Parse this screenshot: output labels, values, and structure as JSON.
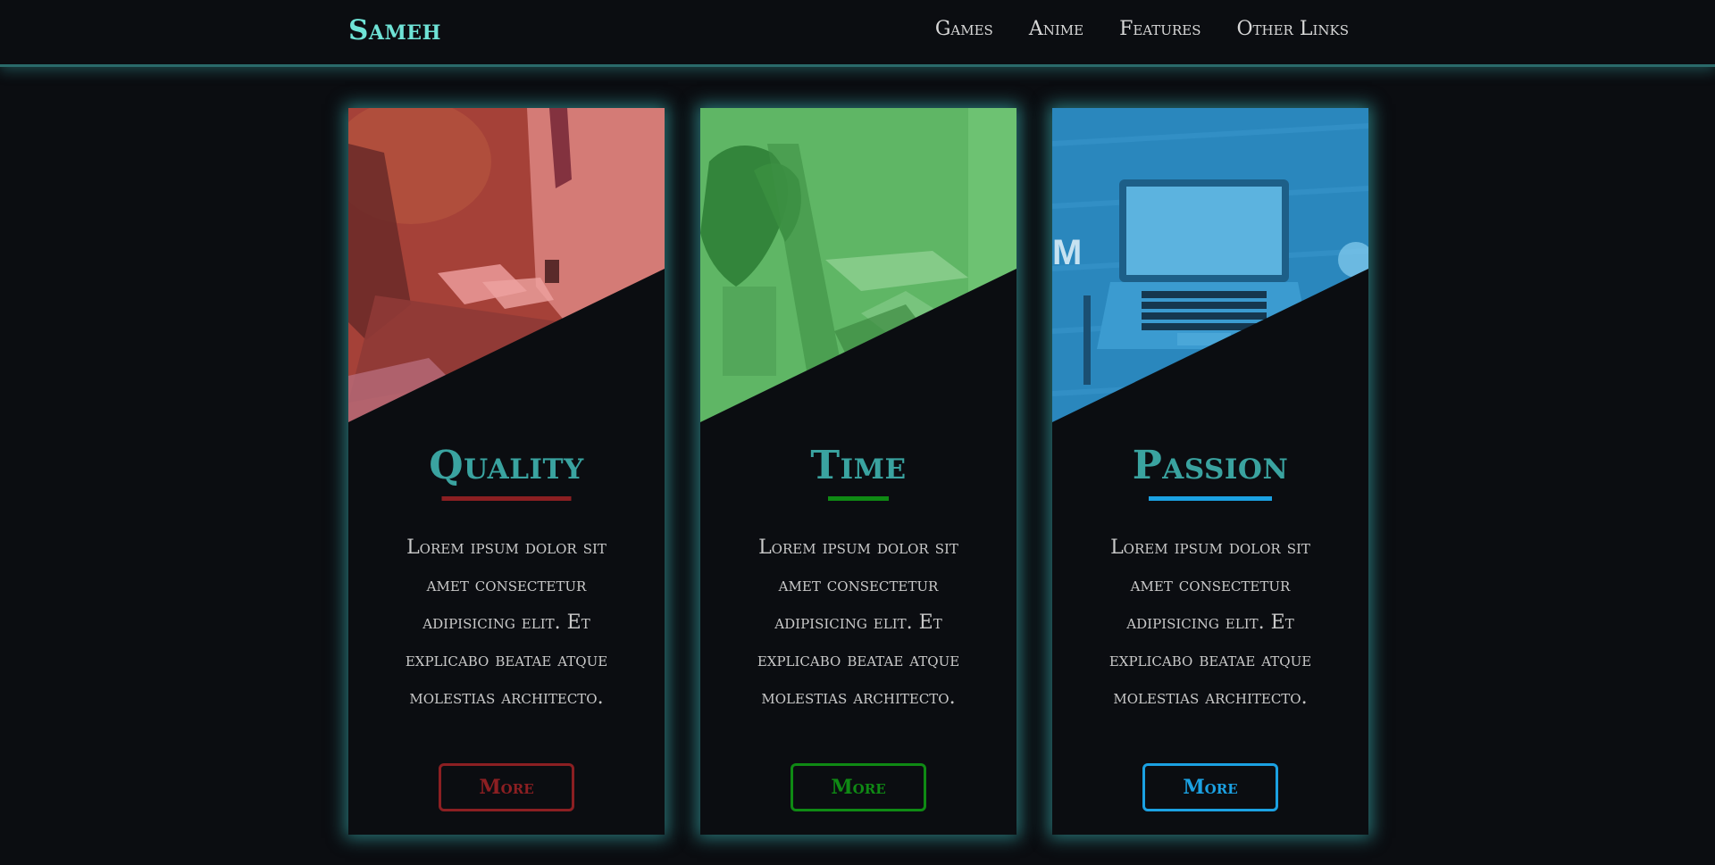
{
  "header": {
    "logo": "Sameh",
    "nav": [
      {
        "label": "Games"
      },
      {
        "label": "Anime"
      },
      {
        "label": "Features"
      },
      {
        "label": "Other Links"
      }
    ]
  },
  "cards": [
    {
      "title": "Quality",
      "text": "Lorem ipsum dolor sit amet consectetur adipisicing elit. Et explicabo beatae atque molestias architecto.",
      "button": "More",
      "accent": "#8c1f22",
      "overlay": "#c9473f",
      "image_icon": "laptop-on-lap-image"
    },
    {
      "title": "Time",
      "text": "Lorem ipsum dolor sit amet consectetur adipisicing elit. Et explicabo beatae atque molestias architecto.",
      "button": "More",
      "accent": "#0f8a14",
      "overlay": "#4fae57",
      "image_icon": "typing-at-desk-image"
    },
    {
      "title": "Passion",
      "text": "Lorem ipsum dolor sit amet consectetur adipisicing elit. Et explicabo beatae atque molestias architecto.",
      "button": "More",
      "accent": "#1ba1e2",
      "overlay": "#2a8fc6",
      "image_icon": "laptop-on-table-image"
    }
  ]
}
